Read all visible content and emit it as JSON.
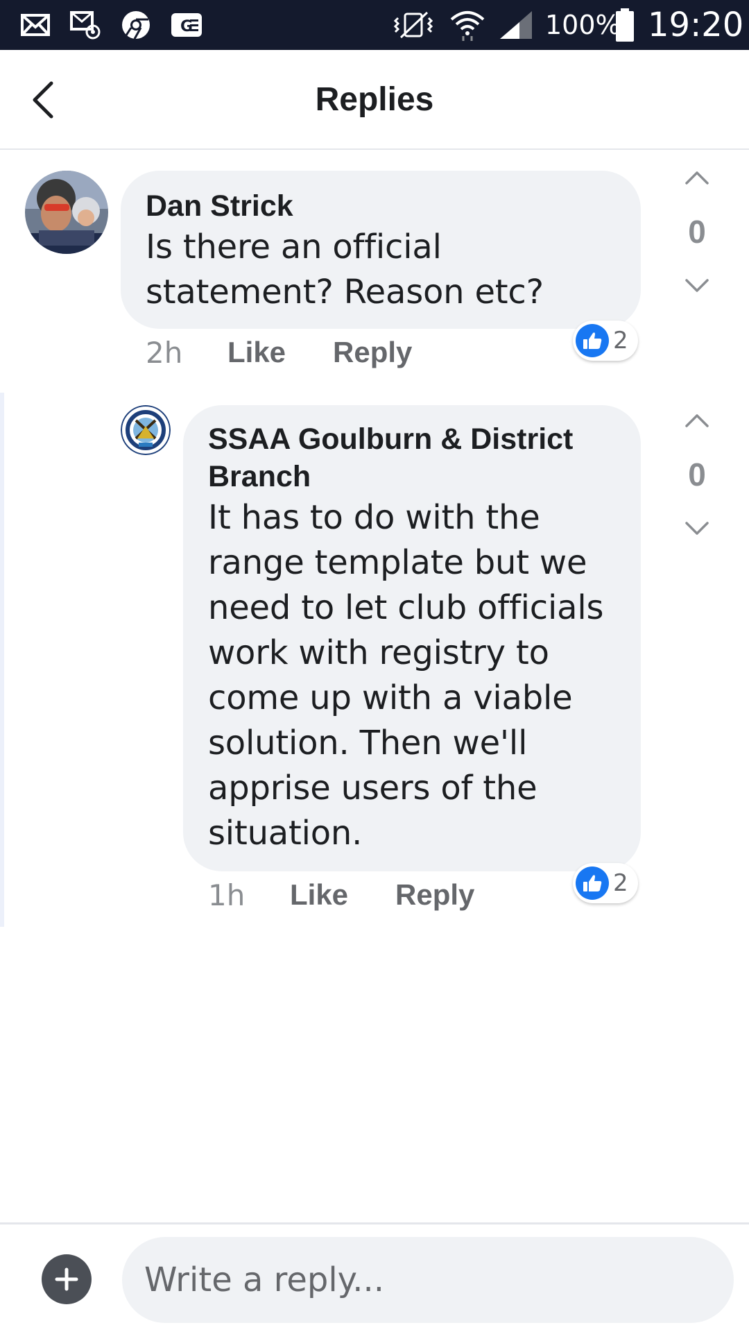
{
  "status_bar": {
    "battery_percent": "100%",
    "time": "19:20",
    "icons": [
      "mail-icon",
      "voicemail-icon",
      "chrome-icon",
      "ge-icon",
      "vibrate-icon",
      "wifi-icon",
      "signal-icon",
      "battery-icon"
    ]
  },
  "header": {
    "title": "Replies",
    "back_icon": "chevron-left-icon"
  },
  "comments": [
    {
      "author": "Dan Strick",
      "text_lines": [
        "Is there an official",
        "statement? Reason etc?"
      ],
      "time": "2h",
      "like_label": "Like",
      "reply_label": "Reply",
      "reaction_count": "2",
      "vote_count": "0"
    },
    {
      "author_lines": [
        "SSAA Goulburn & District",
        "Branch"
      ],
      "text_lines": [
        "It has to do with the",
        "range template but we",
        "need to let club officials",
        "work with registry to",
        "come up with a viable",
        "solution. Then we'll",
        "apprise users of the",
        "situation."
      ],
      "time": "1h",
      "like_label": "Like",
      "reply_label": "Reply",
      "reaction_count": "2",
      "vote_count": "0"
    }
  ],
  "composer": {
    "placeholder": "Write a reply..."
  },
  "colors": {
    "status_bar": "#141a2d",
    "bubble": "#f0f2f5",
    "like_blue": "#1877f2",
    "muted_text": "#65676b"
  }
}
